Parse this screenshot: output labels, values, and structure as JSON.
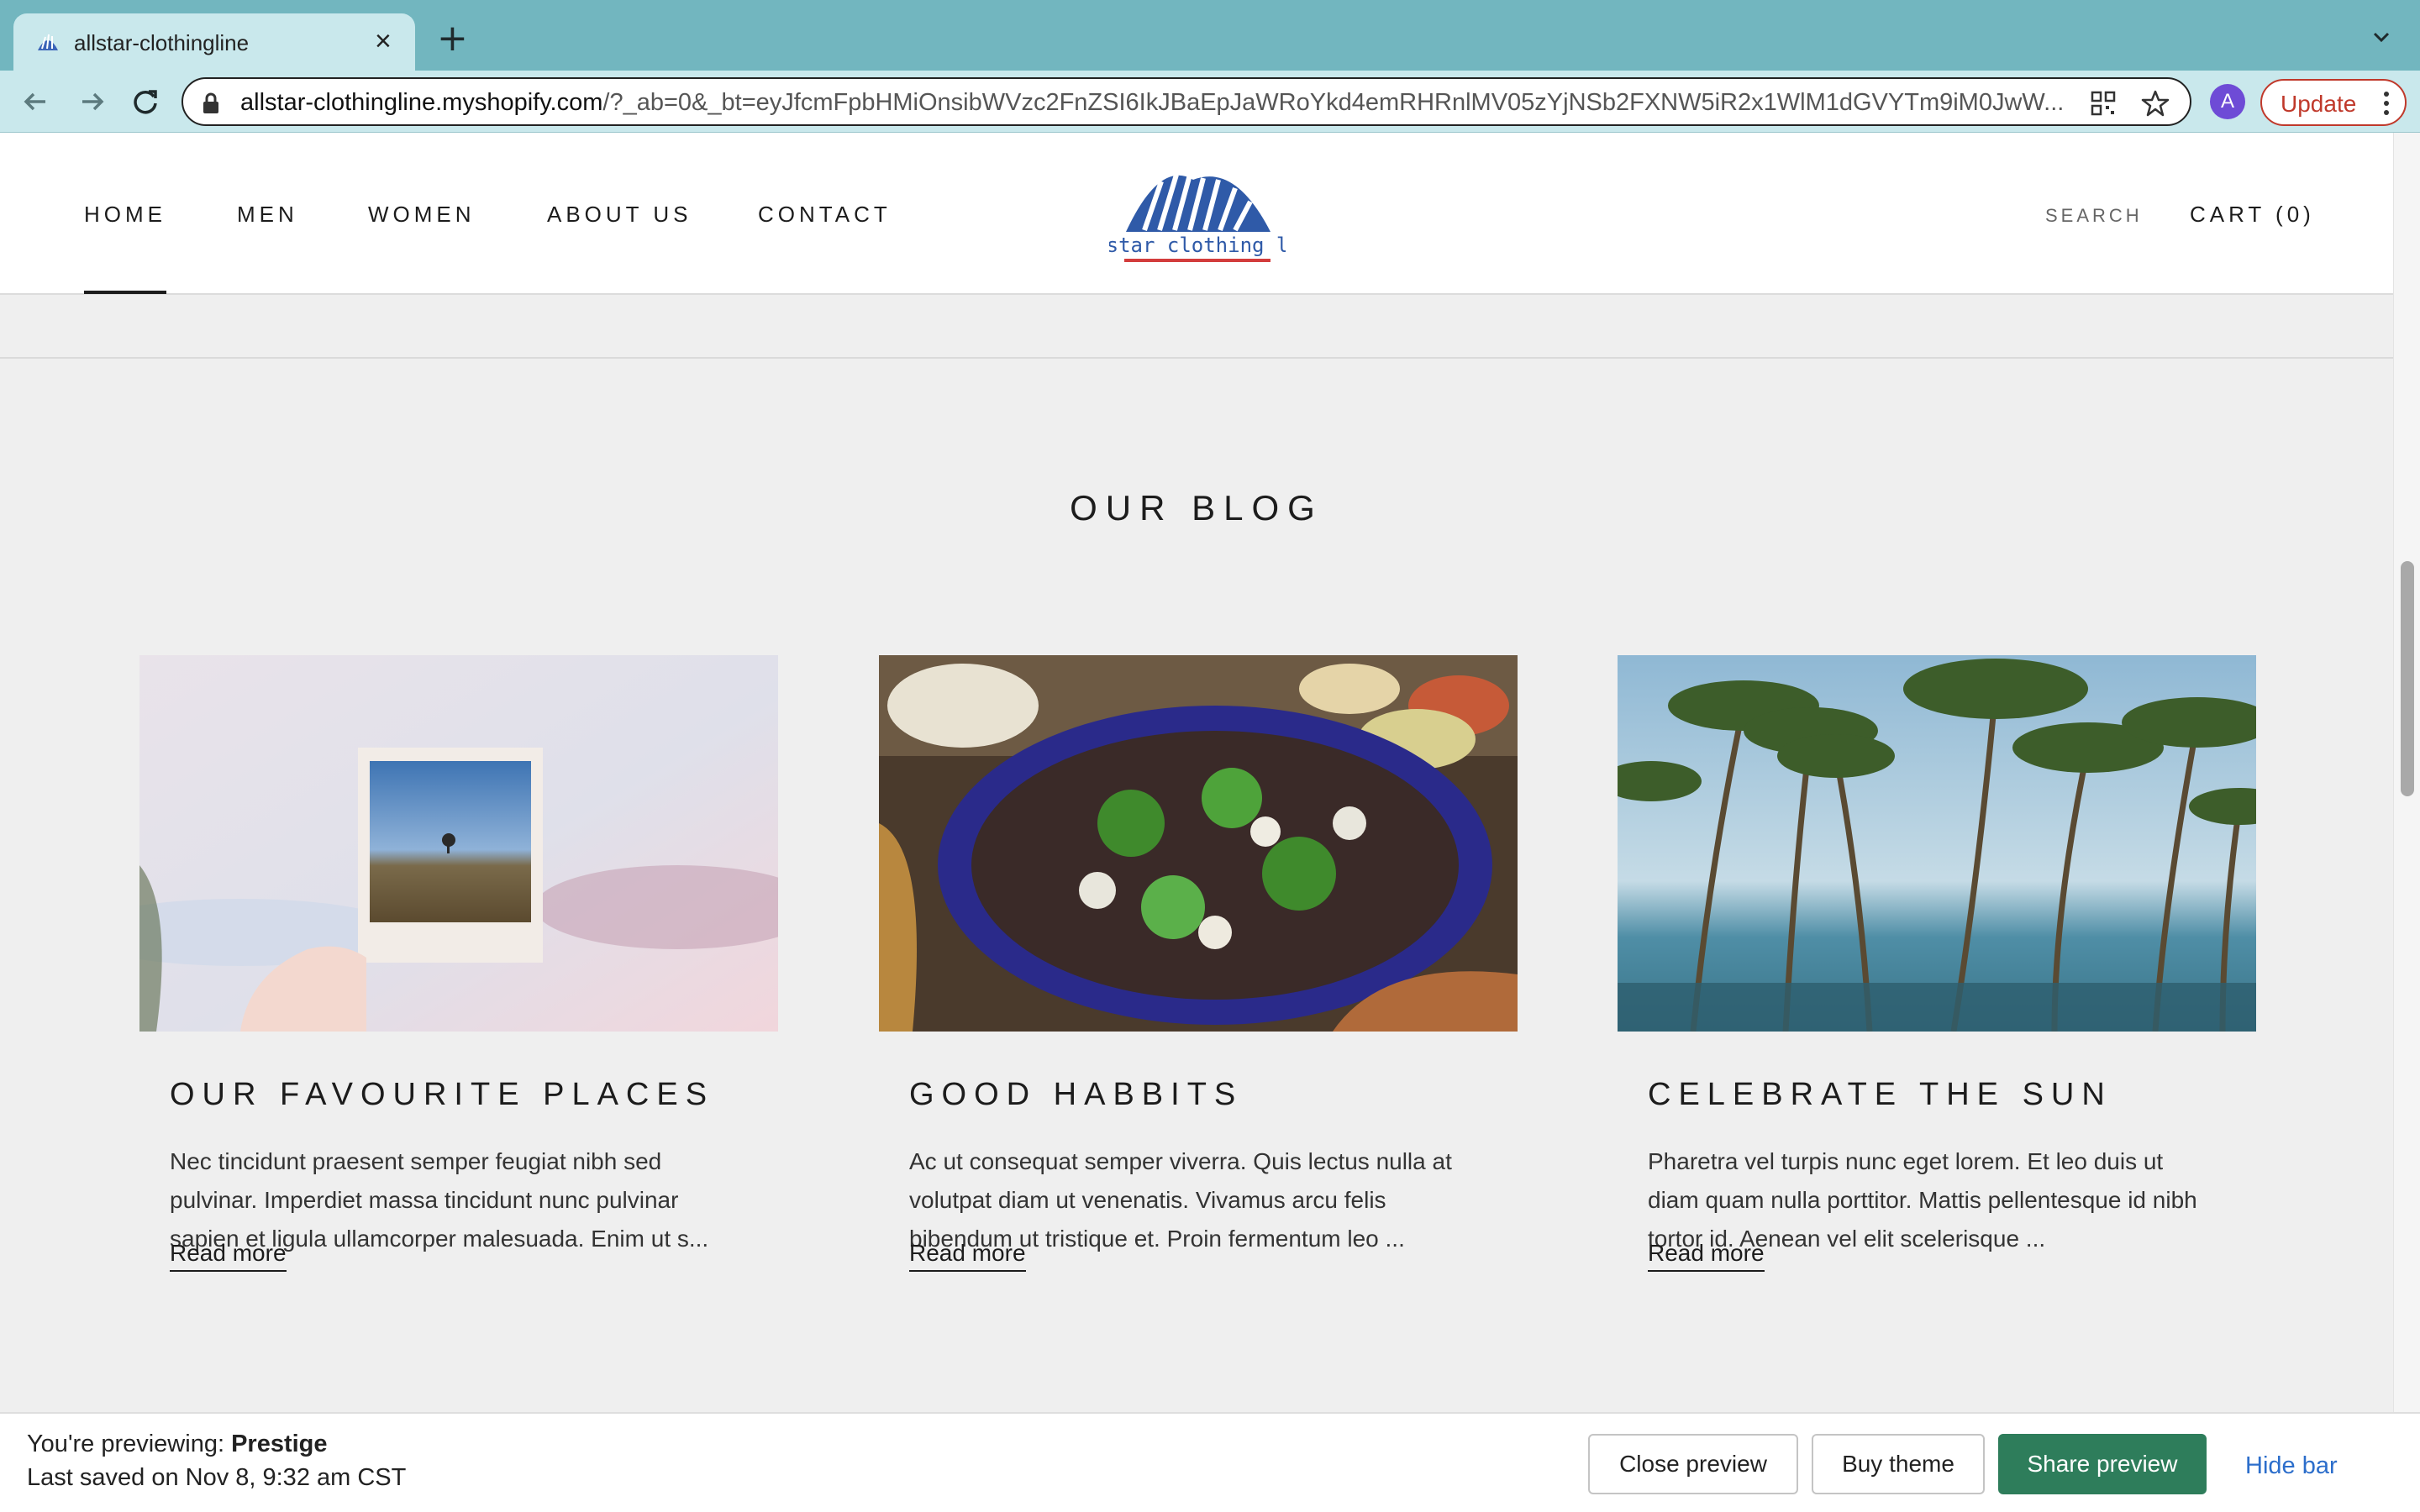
{
  "browser": {
    "tab_title": "allstar-clothingline",
    "url_host": "allstar-clothingline.myshopify.com",
    "url_path": "/?_ab=0&_bt=eyJfcmFpbHMiOnsibWVzc2FnZSI6IkJBaEpJaWRoYkd4emRHRnlMV05zYjNSb2FXNW5iR2x1WlM1dGVYTm9iM0JwW...",
    "avatar_letter": "A",
    "update_label": "Update"
  },
  "store": {
    "nav": [
      "HOME",
      "MEN",
      "WOMEN",
      "ABOUT US",
      "CONTACT"
    ],
    "logo_text": "allstar clothing line",
    "search_label": "SEARCH",
    "cart_label": "CART (0)"
  },
  "blog": {
    "title": "OUR BLOG",
    "posts": [
      {
        "title": "OUR FAVOURITE PLACES",
        "excerpt": "Nec tincidunt praesent semper feugiat nibh sed pulvinar. Imperdiet massa tincidunt nunc pulvinar sapien et ligula ullamcorper malesuada. Enim ut s...",
        "read_more": "Read more"
      },
      {
        "title": "GOOD HABBITS",
        "excerpt": "Ac ut consequat semper viverra. Quis lectus nulla at volutpat diam ut venenatis. Vivamus arcu felis bibendum ut tristique et. Proin fermentum leo ...",
        "read_more": "Read more"
      },
      {
        "title": "CELEBRATE THE SUN",
        "excerpt": "Pharetra vel turpis nunc eget lorem. Et leo duis ut diam quam nulla porttitor. Mattis pellentesque id nibh tortor id. Aenean vel elit scelerisque ...",
        "read_more": "Read more"
      }
    ]
  },
  "preview_bar": {
    "previewing_prefix": "You're previewing: ",
    "theme_name": "Prestige",
    "last_saved": "Last saved on Nov 8, 9:32 am CST",
    "close_preview": "Close preview",
    "buy_theme": "Buy theme",
    "share_preview": "Share preview",
    "hide_bar": "Hide bar"
  },
  "colors": {
    "tab_bar": "#72b6bf",
    "toolbar": "#c9e8ec",
    "share_button": "#2e7d5b",
    "update_accent": "#c0392b",
    "link_blue": "#2c6ecb"
  }
}
